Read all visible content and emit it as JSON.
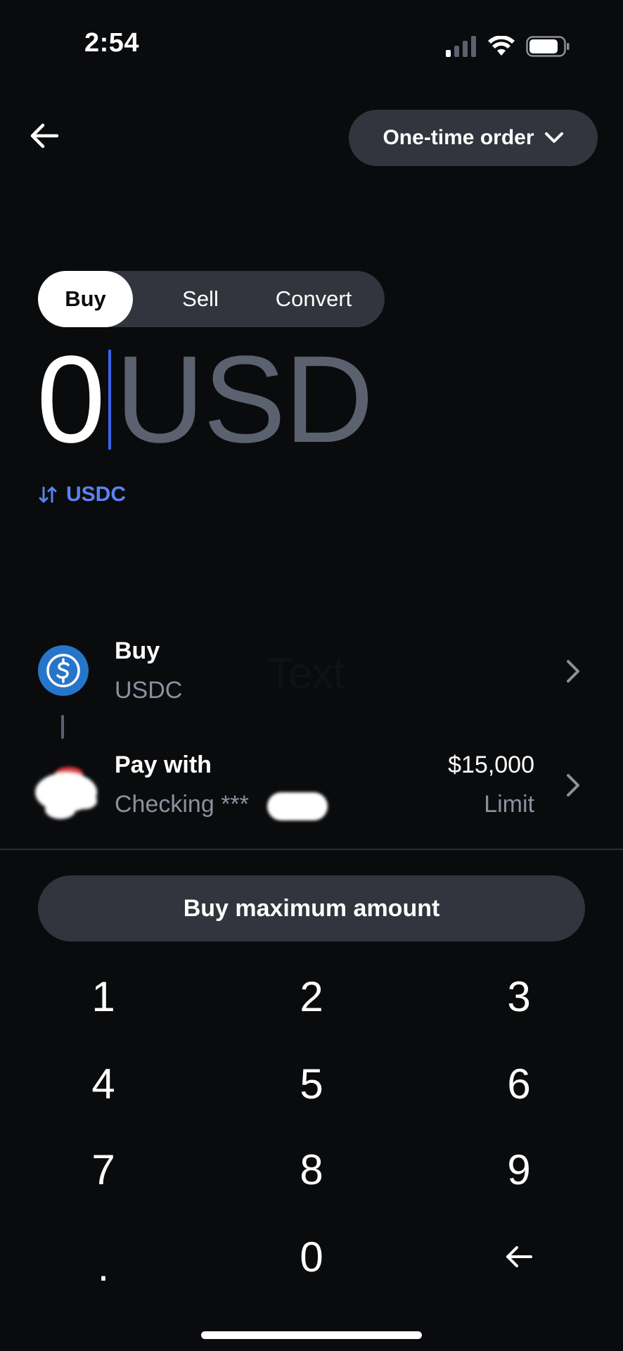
{
  "status_bar": {
    "time": "2:54"
  },
  "header": {
    "order_type_label": "One-time order"
  },
  "tabs": [
    {
      "label": "Buy",
      "active": true
    },
    {
      "label": "Sell",
      "active": false
    },
    {
      "label": "Convert",
      "active": false
    }
  ],
  "amount": {
    "value": "0",
    "currency": "USD"
  },
  "switch_currency": {
    "label": "USDC"
  },
  "buy_row": {
    "title": "Buy",
    "subtitle": "USDC",
    "overlay_text": "Text"
  },
  "pay_row": {
    "title": "Pay with",
    "subtitle": "Checking ***",
    "limit_value": "$15,000",
    "limit_label": "Limit"
  },
  "max_button": {
    "label": "Buy maximum amount"
  },
  "keypad": {
    "keys": [
      "1",
      "2",
      "3",
      "4",
      "5",
      "6",
      "7",
      "8",
      "9",
      ".",
      "0"
    ]
  },
  "colors": {
    "background": "#0a0b0d",
    "surface": "#32353d",
    "accent": "#5b82f0",
    "usdc": "#2775ca",
    "muted": "#8a919e"
  }
}
